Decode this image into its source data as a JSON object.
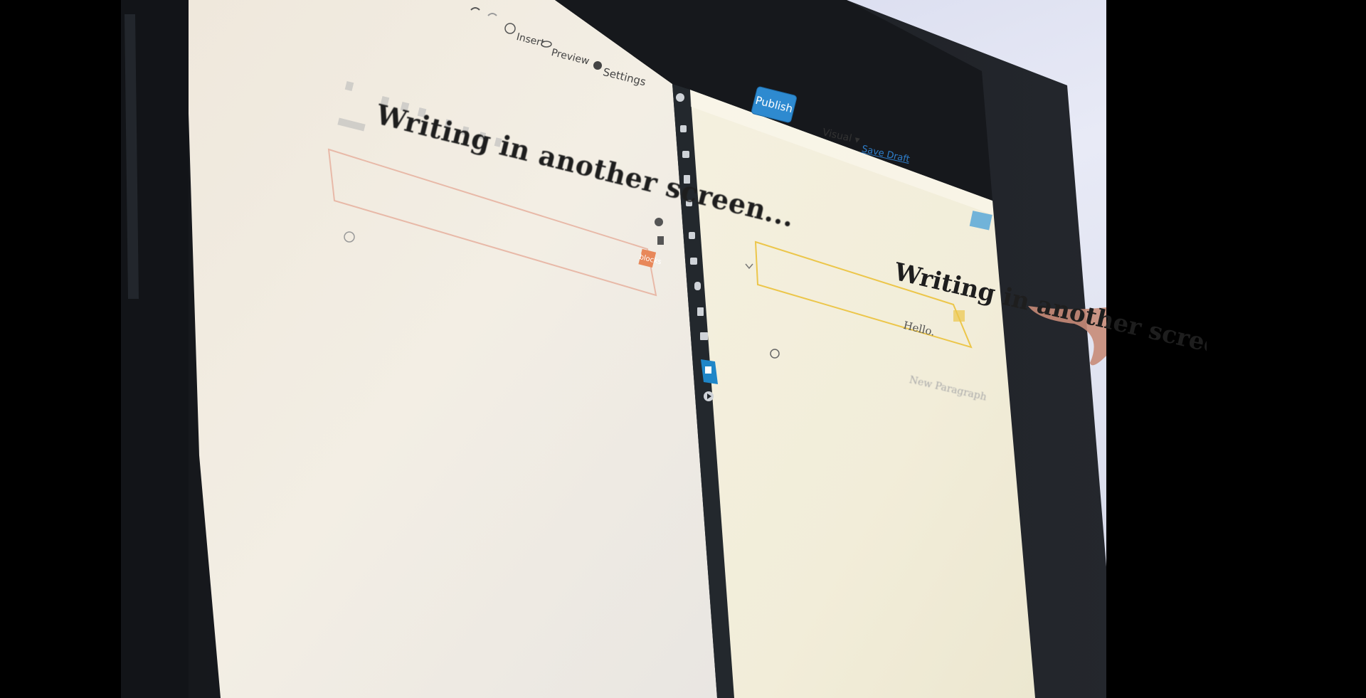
{
  "left_pane": {
    "toolbar": {
      "insert_label": "Insert",
      "preview_label": "Preview",
      "settings_label": "Settings",
      "publish_label": "Publish"
    },
    "post_title": "Writing in another screen...",
    "block_tag": "blocks"
  },
  "right_pane": {
    "mode_label": "Visual ▾",
    "save_draft_label": "Save Draft",
    "post_title": "Writing in another screen...",
    "paragraph_text": "Hello.",
    "new_paragraph_placeholder": "New Paragraph"
  },
  "colors": {
    "accent": "#2e8ad0",
    "selection_orange": "#e8885a",
    "selection_yellow": "#ecc64a",
    "admin_sidebar": "#23282d",
    "sidebar_active": "#1f86c8"
  },
  "icons": [
    "undo-icon",
    "redo-icon",
    "insert-icon",
    "preview-eye-icon",
    "settings-gear-icon",
    "block-gear-icon",
    "trash-icon",
    "plus-circle-icon",
    "chevron-down-icon",
    "dashboard-icon",
    "pin-icon",
    "media-icon",
    "pages-icon",
    "comments-icon",
    "appearance-icon",
    "plugins-icon",
    "users-icon",
    "tools-icon",
    "settings-icon",
    "editor-icon",
    "play-icon"
  ]
}
